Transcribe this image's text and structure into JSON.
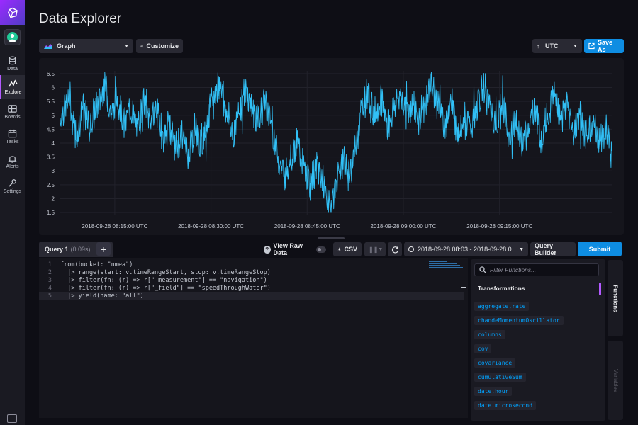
{
  "nav": {
    "items": [
      {
        "label": "Data",
        "icon": "database-icon"
      },
      {
        "label": "Explore",
        "icon": "graph-line-icon",
        "active": true
      },
      {
        "label": "Boards",
        "icon": "dashboards-icon"
      },
      {
        "label": "Tasks",
        "icon": "calendar-icon"
      },
      {
        "label": "Alerts",
        "icon": "bell-icon"
      },
      {
        "label": "Settings",
        "icon": "wrench-icon"
      }
    ]
  },
  "header": {
    "title": "Data Explorer",
    "view_type": "Graph",
    "customize": "Customize",
    "timezone": "UTC",
    "save_as": "Save As"
  },
  "chart_data": {
    "type": "line",
    "x_ticks": [
      "2018-09-28 08:15:00 UTC",
      "2018-09-28 08:30:00 UTC",
      "2018-09-28 08:45:00 UTC",
      "2018-09-28 09:00:00 UTC",
      "2018-09-28 09:15:00 UTC"
    ],
    "y_ticks": [
      "6.5",
      "6",
      "5.5",
      "5",
      "4.5",
      "4",
      "3.5",
      "3",
      "2.5",
      "2",
      "1.5"
    ],
    "ylim": [
      1.4,
      6.6
    ],
    "xlim_minutes": [
      6.5,
      92.5
    ],
    "grid": true,
    "series": [
      {
        "color": "#31c0f6",
        "points": [
          [
            6.5,
            4.9
          ],
          [
            8,
            5.6
          ],
          [
            9,
            4.2
          ],
          [
            10,
            5.3
          ],
          [
            11,
            4.6
          ],
          [
            12.5,
            5.5
          ],
          [
            13.5,
            6.1
          ],
          [
            14.5,
            5.0
          ],
          [
            15.5,
            5.7
          ],
          [
            16.5,
            4.6
          ],
          [
            17.5,
            5.3
          ],
          [
            18.5,
            4.4
          ],
          [
            19.5,
            5.6
          ],
          [
            20.5,
            4.8
          ],
          [
            21.5,
            5.3
          ],
          [
            22.5,
            4.1
          ],
          [
            23.5,
            4.7
          ],
          [
            24.5,
            3.8
          ],
          [
            25.5,
            4.3
          ],
          [
            26.5,
            3.6
          ],
          [
            27.5,
            4.6
          ],
          [
            28.5,
            3.8
          ],
          [
            29.5,
            4.9
          ],
          [
            30.5,
            5.7
          ],
          [
            31.5,
            6.3
          ],
          [
            32.5,
            5.0
          ],
          [
            33.5,
            4.3
          ],
          [
            34.5,
            5.3
          ],
          [
            35.5,
            5.9
          ],
          [
            36.5,
            5.2
          ],
          [
            37.5,
            4.8
          ],
          [
            38.5,
            5.6
          ],
          [
            39.5,
            4.6
          ],
          [
            40.5,
            3.5
          ],
          [
            41.5,
            2.8
          ],
          [
            42.5,
            3.6
          ],
          [
            43.5,
            4.0
          ],
          [
            44.5,
            3.1
          ],
          [
            45.5,
            2.4
          ],
          [
            46.5,
            3.2
          ],
          [
            47.5,
            2.6
          ],
          [
            48.5,
            1.6
          ],
          [
            49.5,
            2.5
          ],
          [
            50.5,
            3.4
          ],
          [
            51.5,
            2.8
          ],
          [
            52.5,
            3.7
          ],
          [
            53.5,
            5.3
          ],
          [
            54.5,
            5.8
          ],
          [
            55.5,
            5.0
          ],
          [
            56.5,
            5.6
          ],
          [
            57.5,
            4.7
          ],
          [
            58.5,
            5.2
          ],
          [
            59.5,
            5.8
          ],
          [
            60.5,
            5.1
          ],
          [
            61.5,
            5.4
          ],
          [
            62.5,
            4.8
          ],
          [
            63.5,
            5.6
          ],
          [
            64.5,
            6.1
          ],
          [
            65.5,
            5.3
          ],
          [
            66.5,
            4.7
          ],
          [
            67.5,
            5.5
          ],
          [
            68.5,
            4.3
          ],
          [
            69.5,
            5.0
          ],
          [
            70.5,
            4.5
          ],
          [
            71.5,
            5.3
          ],
          [
            72.5,
            6.0
          ],
          [
            73.5,
            5.4
          ],
          [
            74.5,
            4.6
          ],
          [
            75.5,
            5.5
          ],
          [
            76.5,
            4.3
          ],
          [
            77.5,
            4.8
          ],
          [
            78.5,
            3.9
          ],
          [
            79.5,
            4.6
          ],
          [
            80.5,
            5.3
          ],
          [
            81.5,
            4.2
          ],
          [
            82.5,
            5.0
          ],
          [
            83.5,
            5.8
          ],
          [
            84.5,
            4.9
          ],
          [
            85.5,
            5.4
          ],
          [
            86.5,
            4.4
          ],
          [
            87.5,
            5.1
          ],
          [
            88.5,
            4.2
          ],
          [
            89.5,
            4.8
          ],
          [
            90.5,
            4.1
          ],
          [
            91.5,
            4.6
          ],
          [
            92.5,
            3.7
          ]
        ]
      }
    ]
  },
  "query": {
    "tab_label": "Query 1",
    "tab_time": "(0.09s)",
    "raw_toggle": "View Raw Data",
    "csv": "CSV",
    "time_range": "2018-09-28 08:03 - 2018-09-28 0...",
    "query_builder": "Query Builder",
    "submit": "Submit"
  },
  "editor": {
    "lines": [
      {
        "n": "1",
        "text": "from(bucket: \"nmea\")"
      },
      {
        "n": "2",
        "text": "  |> range(start: v.timeRangeStart, stop: v.timeRangeStop)"
      },
      {
        "n": "3",
        "text": "  |> filter(fn: (r) => r[\"_measurement\"] == \"navigation\")"
      },
      {
        "n": "4",
        "text": "  |> filter(fn: (r) => r[\"_field\"] == \"speedThroughWater\")"
      },
      {
        "n": "5",
        "text": "  |> yield(name: \"all\")"
      }
    ]
  },
  "functions": {
    "search_placeholder": "Filter Functions...",
    "heading": "Transformations",
    "items": [
      "aggregate.rate",
      "chandeMomentumOscillator",
      "columns",
      "cov",
      "covariance",
      "cumulativeSum",
      "date.hour",
      "date.microsecond"
    ],
    "tab_functions": "Functions",
    "tab_variables": "Variables"
  }
}
